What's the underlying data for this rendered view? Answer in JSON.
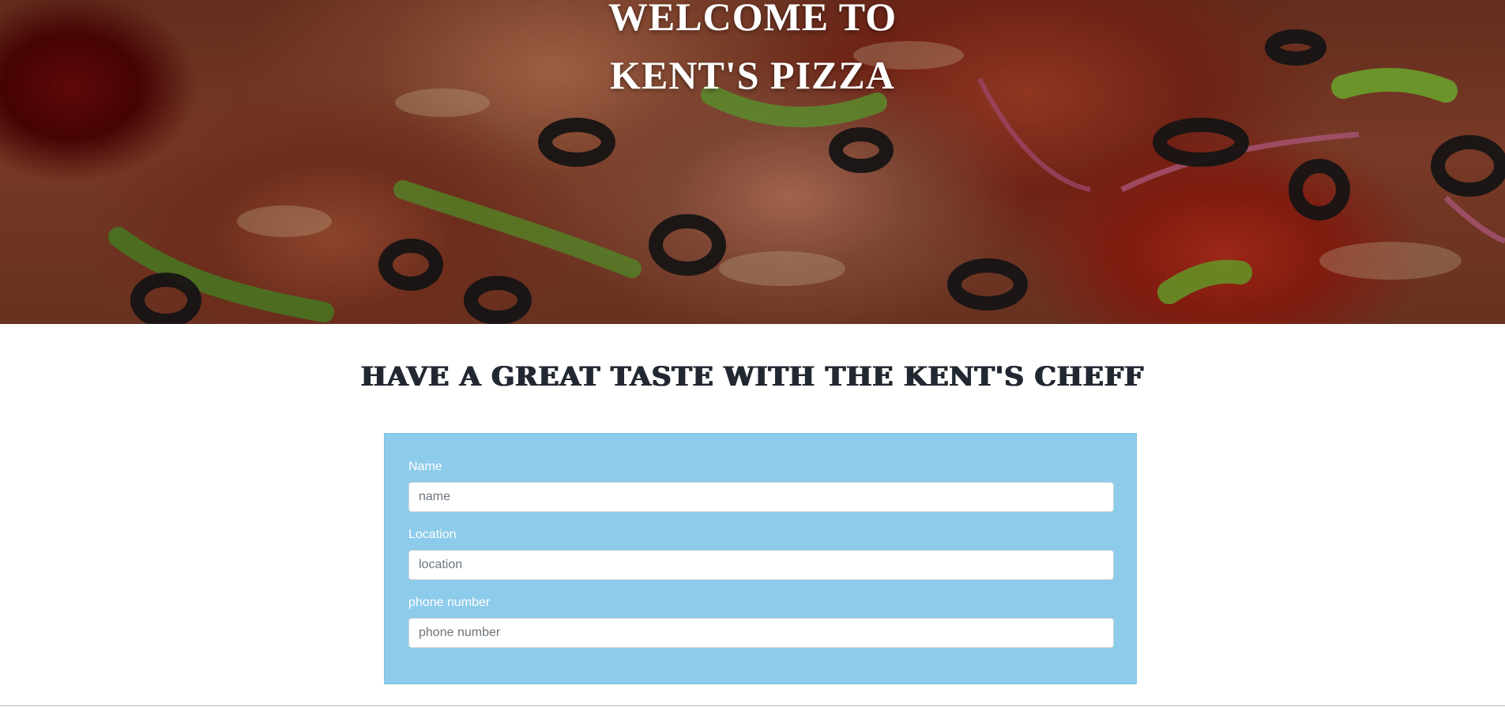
{
  "hero": {
    "title_line1": "WELCOME TO",
    "title_line2": "KENT'S PIZZA"
  },
  "tagline": "HAVE A GREAT TASTE WITH THE KENT'S CHEFF",
  "form": {
    "background_color": "#8dcbea",
    "fields": [
      {
        "label": "Name",
        "placeholder": "name",
        "value": ""
      },
      {
        "label": "Location",
        "placeholder": "location",
        "value": ""
      },
      {
        "label": "phone number",
        "placeholder": "phone number",
        "value": ""
      }
    ]
  },
  "colors": {
    "tagline_text": "#222831",
    "label_text": "#ffffff"
  }
}
